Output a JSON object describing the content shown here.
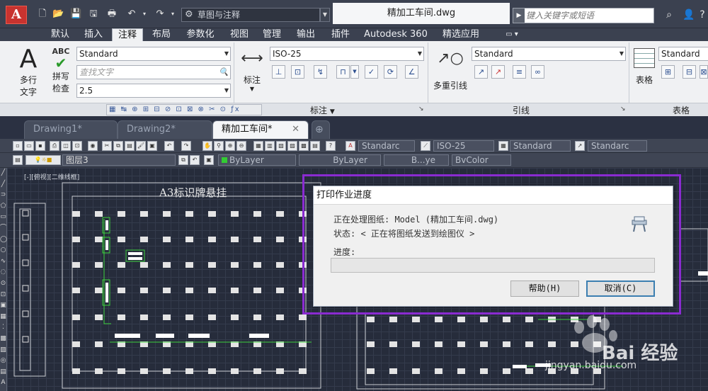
{
  "titlebar": {
    "logo": "A",
    "workspace": "草图与注释",
    "document_title": "精加工车间.dwg",
    "search_placeholder": "键入关键字或短语"
  },
  "ribbon_tabs": [
    "默认",
    "插入",
    "注释",
    "布局",
    "参数化",
    "视图",
    "管理",
    "输出",
    "插件",
    "Autodesk 360",
    "精选应用"
  ],
  "active_tab": "注释",
  "ribbon": {
    "text_panel": {
      "multiline_text_label_line1": "多行",
      "multiline_text_label_line2": "文字",
      "spell_label_line1": "拼写",
      "spell_label_line2": "检查",
      "abc_label": "ABC",
      "text_style": "Standard",
      "find_text_placeholder": "查找文字",
      "text_height": "2.5"
    },
    "dim_panel": {
      "dim_label": "标注",
      "dim_style": "ISO-25",
      "footer": "标注"
    },
    "leader_panel": {
      "leader_label": "多重引线",
      "leader_style": "Standard",
      "footer": "引线"
    },
    "table_panel": {
      "table_label": "表格",
      "table_style": "Standard",
      "footer": "表格"
    }
  },
  "doc_tabs": [
    {
      "label": "Drawing1*",
      "active": false
    },
    {
      "label": "Drawing2*",
      "active": false
    },
    {
      "label": "精加工车间*",
      "active": true
    }
  ],
  "toolbar1": {
    "text_style": "Standarc",
    "dim_style": "ISO-25",
    "table_style": "Standard",
    "mleader_style": "Standarc"
  },
  "toolbar2": {
    "layer": "图层3",
    "color": "ByLayer",
    "linetype": "ByLayer",
    "lineweight": "B...ye",
    "plotstyle": "BvColor"
  },
  "canvas": {
    "view_label": "[-][俯视][二维线框]",
    "drawing_title": "A3标识牌悬挂"
  },
  "dialog": {
    "title": "打印作业进度",
    "processing": "正在处理图纸: Model (精加工车间.dwg)",
    "status": "状态: < 正在将图纸发送到绘图仪 >",
    "progress_label": "进度:",
    "progress_value": 0,
    "help_button": "帮助(H)",
    "cancel_button": "取消(C)"
  },
  "watermark": {
    "brand": "Bai 经验",
    "url": "jingyan.baidu.com"
  }
}
